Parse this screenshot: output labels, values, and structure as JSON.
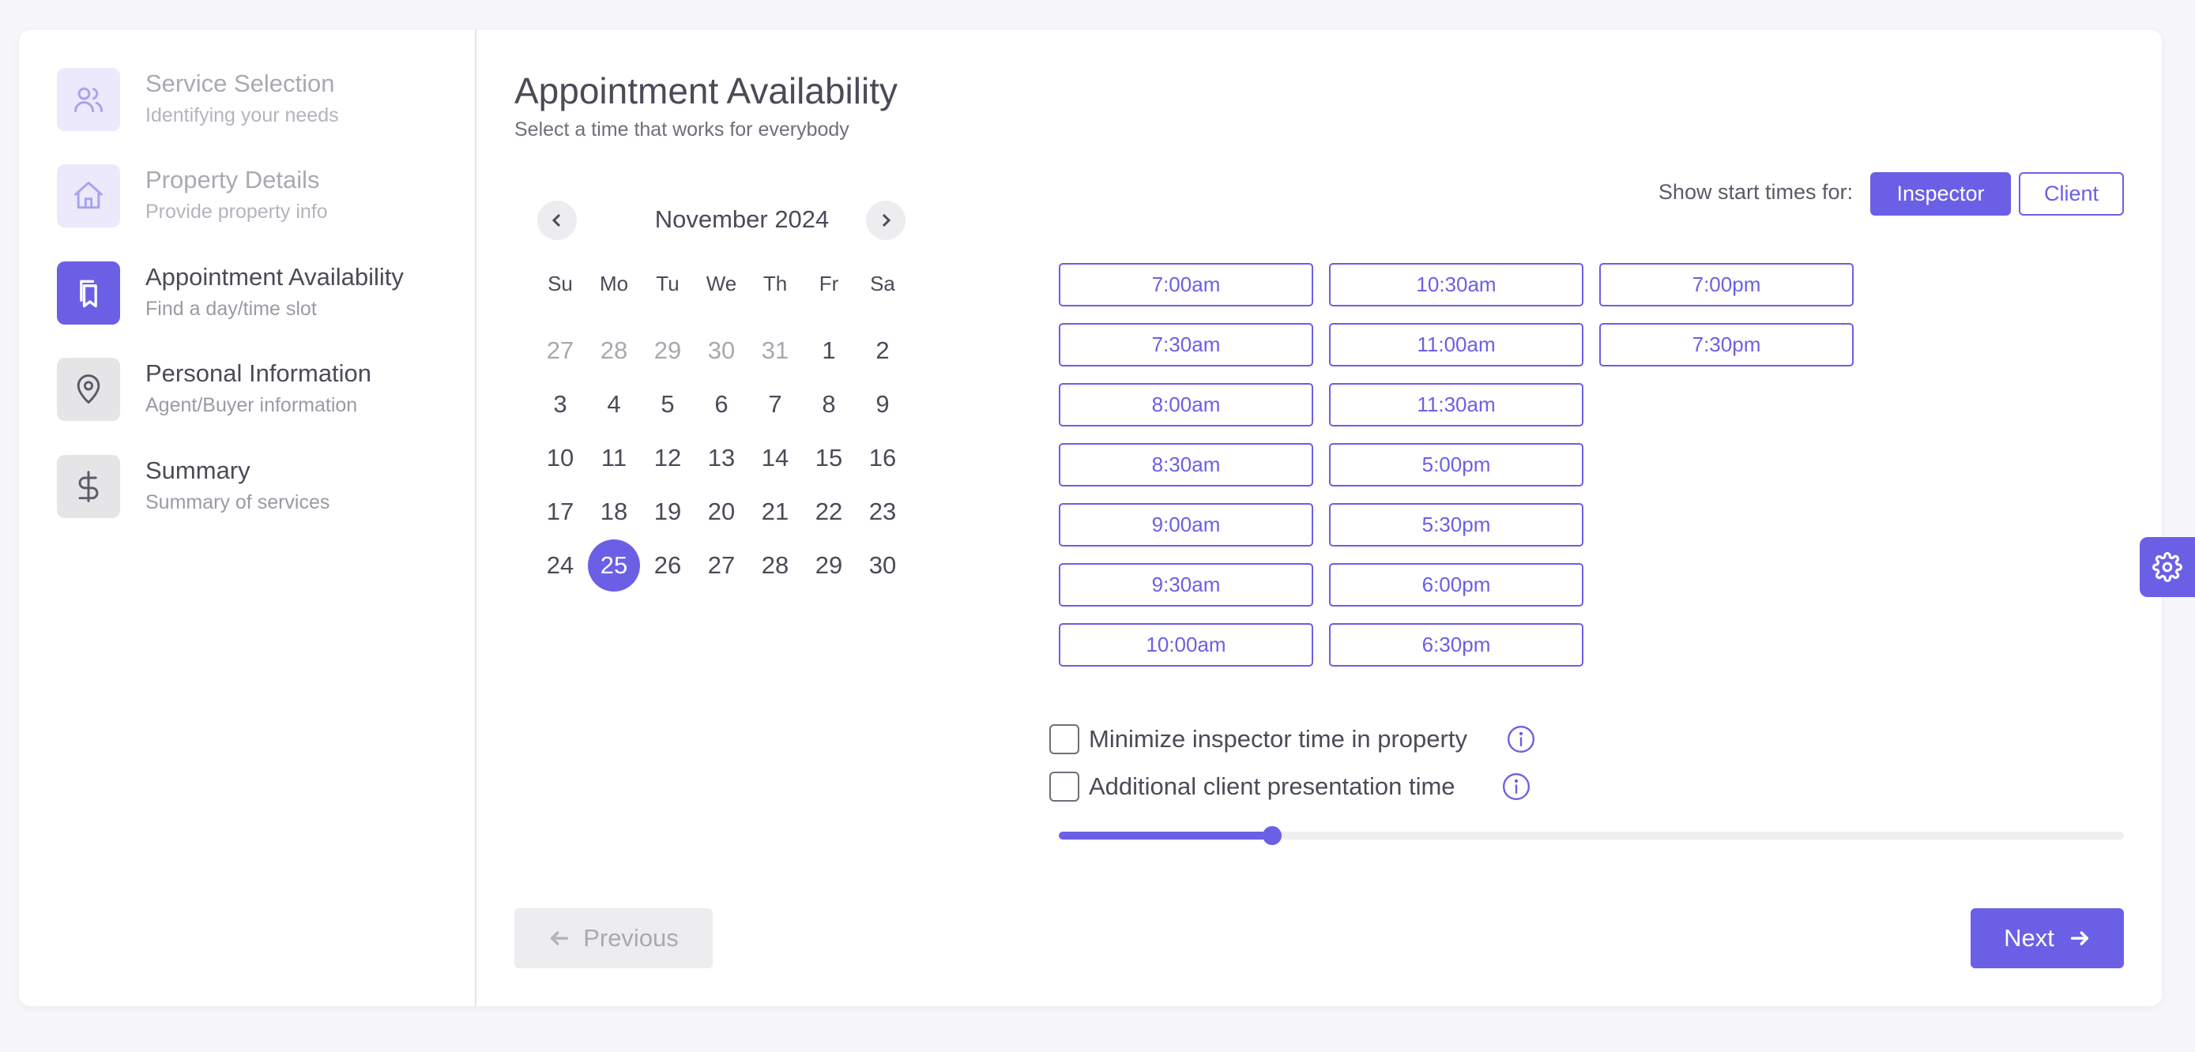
{
  "sidebar": {
    "steps": [
      {
        "title": "Service Selection",
        "subtitle": "Identifying your needs",
        "icon": "users-icon",
        "state": "done"
      },
      {
        "title": "Property Details",
        "subtitle": "Provide property info",
        "icon": "home-icon",
        "state": "done"
      },
      {
        "title": "Appointment Availability",
        "subtitle": "Find a day/time slot",
        "icon": "bookmarks-icon",
        "state": "active"
      },
      {
        "title": "Personal Information",
        "subtitle": "Agent/Buyer information",
        "icon": "map-pin-icon",
        "state": "todo"
      },
      {
        "title": "Summary",
        "subtitle": "Summary of services",
        "icon": "dollar-icon",
        "state": "todo"
      }
    ]
  },
  "main": {
    "title": "Appointment Availability",
    "subtitle": "Select a time that works for everybody"
  },
  "calendar": {
    "month_label": "November 2024",
    "weekdays": [
      "Su",
      "Mo",
      "Tu",
      "We",
      "Th",
      "Fr",
      "Sa"
    ],
    "weeks": [
      [
        "27",
        "28",
        "29",
        "30",
        "31",
        "1",
        "2"
      ],
      [
        "3",
        "4",
        "5",
        "6",
        "7",
        "8",
        "9"
      ],
      [
        "10",
        "11",
        "12",
        "13",
        "14",
        "15",
        "16"
      ],
      [
        "17",
        "18",
        "19",
        "20",
        "21",
        "22",
        "23"
      ],
      [
        "24",
        "25",
        "26",
        "27",
        "28",
        "29",
        "30"
      ]
    ],
    "selected_day": "25"
  },
  "start_times": {
    "label": "Show start times for:",
    "options": [
      "Inspector",
      "Client"
    ],
    "selected": "Inspector"
  },
  "time_slots": [
    [
      "7:00am",
      "7:30am",
      "8:00am",
      "8:30am",
      "9:00am",
      "9:30am",
      "10:00am"
    ],
    [
      "10:30am",
      "11:00am",
      "11:30am",
      "5:00pm",
      "5:30pm",
      "6:00pm",
      "6:30pm"
    ],
    [
      "7:00pm",
      "7:30pm"
    ]
  ],
  "options": {
    "minimize_label": "Minimize inspector time in property",
    "presentation_label": "Additional client presentation time",
    "slider_value_fraction": 0.2
  },
  "footer": {
    "previous_label": "Previous",
    "next_label": "Next"
  },
  "colors": {
    "accent": "#6b5fe6",
    "accent_light": "#ebe9fb"
  }
}
